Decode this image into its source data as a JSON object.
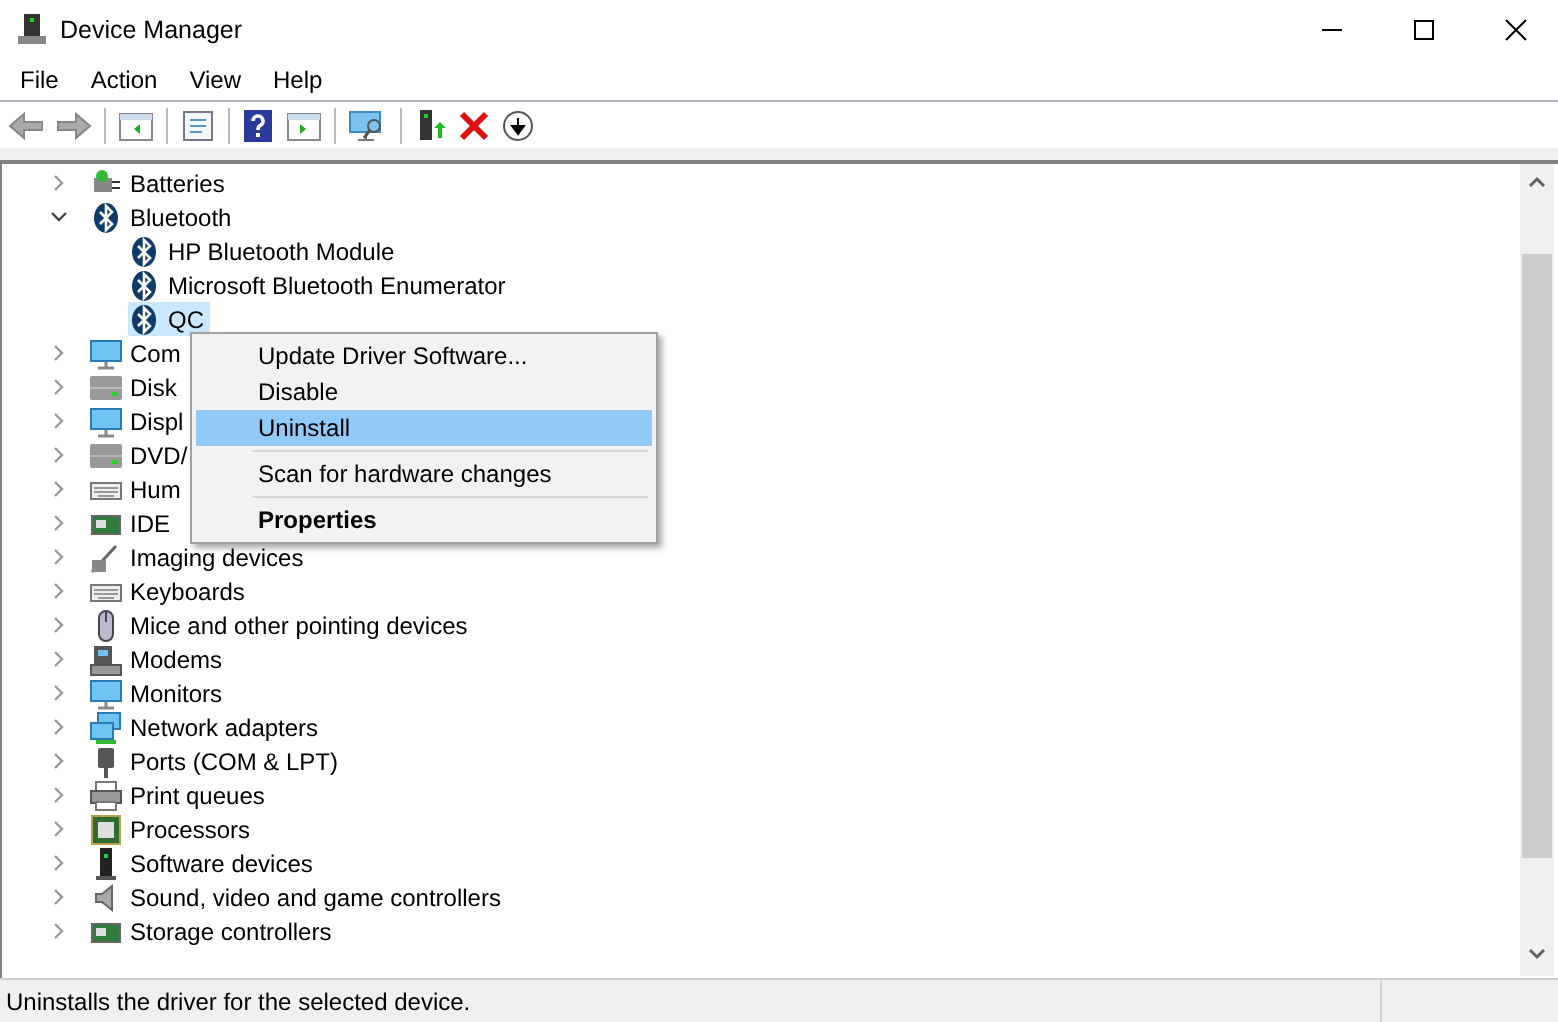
{
  "window": {
    "title": "Device Manager"
  },
  "menu": [
    "File",
    "Action",
    "View",
    "Help"
  ],
  "tree": [
    {
      "label": "Batteries",
      "kind": "battery",
      "expanded": false,
      "selected": false
    },
    {
      "label": "Bluetooth",
      "kind": "bluetooth",
      "expanded": true,
      "selected": false,
      "children": [
        {
          "label": "HP Bluetooth Module",
          "kind": "bluetooth",
          "selected": false
        },
        {
          "label": "Microsoft Bluetooth Enumerator",
          "kind": "bluetooth",
          "selected": false
        },
        {
          "label": "QC",
          "kind": "bluetooth",
          "selected": true
        }
      ]
    },
    {
      "label": "Com",
      "kind": "monitor",
      "expanded": false,
      "selected": false
    },
    {
      "label": "Disk",
      "kind": "disk",
      "expanded": false,
      "selected": false
    },
    {
      "label": "Displ",
      "kind": "monitor",
      "expanded": false,
      "selected": false
    },
    {
      "label": "DVD/",
      "kind": "disk",
      "expanded": false,
      "selected": false
    },
    {
      "label": "Hum",
      "kind": "keyboard",
      "expanded": false,
      "selected": false
    },
    {
      "label": "IDE",
      "kind": "card",
      "expanded": false,
      "selected": false
    },
    {
      "label": "Imaging devices",
      "kind": "camera",
      "expanded": false,
      "selected": false
    },
    {
      "label": "Keyboards",
      "kind": "keyboard",
      "expanded": false,
      "selected": false
    },
    {
      "label": "Mice and other pointing devices",
      "kind": "mouse",
      "expanded": false,
      "selected": false
    },
    {
      "label": "Modems",
      "kind": "modem",
      "expanded": false,
      "selected": false
    },
    {
      "label": "Monitors",
      "kind": "monitor",
      "expanded": false,
      "selected": false
    },
    {
      "label": "Network adapters",
      "kind": "network",
      "expanded": false,
      "selected": false
    },
    {
      "label": "Ports (COM & LPT)",
      "kind": "port",
      "expanded": false,
      "selected": false
    },
    {
      "label": "Print queues",
      "kind": "printer",
      "expanded": false,
      "selected": false
    },
    {
      "label": "Processors",
      "kind": "chip",
      "expanded": false,
      "selected": false
    },
    {
      "label": "Software devices",
      "kind": "tower",
      "expanded": false,
      "selected": false
    },
    {
      "label": "Sound, video and game controllers",
      "kind": "speaker",
      "expanded": false,
      "selected": false
    },
    {
      "label": "Storage controllers",
      "kind": "storage",
      "expanded": false,
      "selected": false
    }
  ],
  "context_menu": [
    {
      "label": "Update Driver Software...",
      "kind": "item",
      "selected": false
    },
    {
      "label": "Disable",
      "kind": "item",
      "selected": false
    },
    {
      "label": "Uninstall",
      "kind": "item",
      "selected": true
    },
    {
      "kind": "separator"
    },
    {
      "label": "Scan for hardware changes",
      "kind": "item",
      "selected": false
    },
    {
      "kind": "separator"
    },
    {
      "label": "Properties",
      "kind": "default",
      "selected": false
    }
  ],
  "status_bar": "Uninstalls the driver for the selected device."
}
